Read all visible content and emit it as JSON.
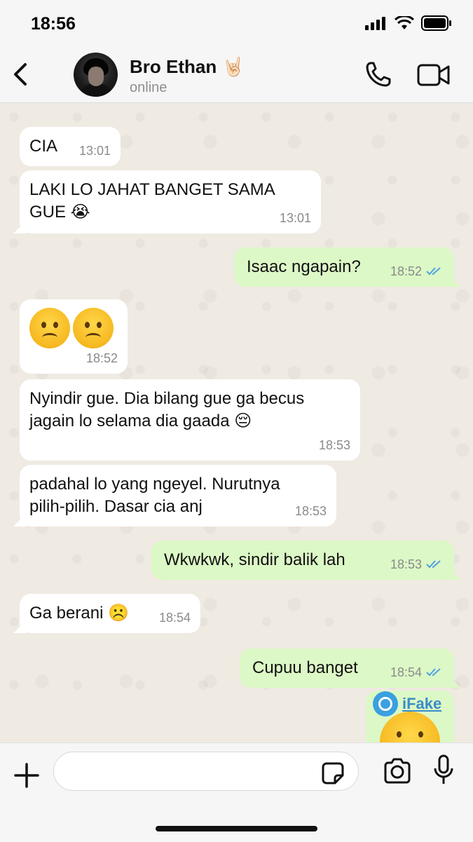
{
  "status_bar": {
    "time": "18:56"
  },
  "header": {
    "back_label": "Back",
    "contact_name": "Bro Ethan 🤘🏻",
    "contact_status": "online"
  },
  "messages": [
    {
      "dir": "in",
      "text": "CIA",
      "time": "13:01"
    },
    {
      "dir": "in",
      "text": "LAKI LO JAHAT BANGET SAMA GUE 😭",
      "time": "13:01"
    },
    {
      "dir": "out",
      "text": "Isaac ngapain?",
      "time": "18:52",
      "status": "read"
    },
    {
      "dir": "in",
      "text": "☹️☹️",
      "time": "18:52"
    },
    {
      "dir": "in",
      "text": "Nyindir gue. Dia bilang gue ga becus jagain lo selama dia gaada 😔",
      "time": "18:53"
    },
    {
      "dir": "in",
      "text": "padahal lo yang ngeyel. Nurutnya pilih-pilih. Dasar cia anj",
      "time": "18:53"
    },
    {
      "dir": "out",
      "text": "Wkwkwk, sindir balik lah",
      "time": "18:53",
      "status": "read"
    },
    {
      "dir": "in",
      "text": "Ga berani ☹️",
      "time": "18:54"
    },
    {
      "dir": "out",
      "text": "Cupuu banget",
      "time": "18:54",
      "status": "read"
    },
    {
      "dir": "out",
      "text": "😋",
      "time": ""
    }
  ],
  "watermark": {
    "text": "iFake"
  },
  "composer": {
    "placeholder": ""
  },
  "colors": {
    "outgoing_bubble": "#dcf8c6",
    "incoming_bubble": "#ffffff",
    "read_ticks": "#4fa3e0",
    "chat_bg": "#efeae2"
  }
}
